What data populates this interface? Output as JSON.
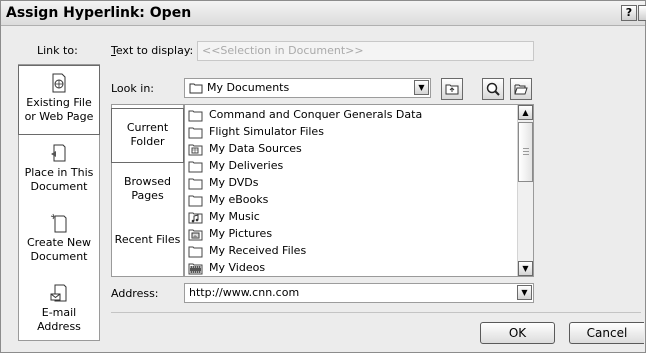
{
  "window": {
    "title": "Assign Hyperlink: Open",
    "help_glyph": "?",
    "close_glyph": "✕"
  },
  "link_to": {
    "label": "Link to:",
    "items": [
      {
        "label": "Existing File or Web Page",
        "icon": "file-web-icon",
        "active": true
      },
      {
        "label": "Place in This Document",
        "icon": "place-in-document-icon"
      },
      {
        "label": "Create New Document",
        "icon": "new-document-icon"
      },
      {
        "label": "E-mail Address",
        "icon": "email-icon"
      }
    ]
  },
  "text_to_display": {
    "label": "Text to display:",
    "value": "<<Selection in Document>>"
  },
  "look_in": {
    "label": "Look in:",
    "value": "My Documents"
  },
  "browse": {
    "items": [
      {
        "label": "Current Folder",
        "active": true
      },
      {
        "label": "Browsed Pages"
      },
      {
        "label": "Recent Files"
      }
    ]
  },
  "files": [
    {
      "name": "Command and Conquer Generals Data",
      "icon": "folder-icon"
    },
    {
      "name": "Flight Simulator Files",
      "icon": "folder-icon"
    },
    {
      "name": "My Data Sources",
      "icon": "data-sources-folder-icon"
    },
    {
      "name": "My Deliveries",
      "icon": "folder-icon"
    },
    {
      "name": "My DVDs",
      "icon": "folder-icon"
    },
    {
      "name": "My eBooks",
      "icon": "folder-icon"
    },
    {
      "name": "My Music",
      "icon": "music-folder-icon"
    },
    {
      "name": "My Pictures",
      "icon": "pictures-folder-icon"
    },
    {
      "name": "My Received Files",
      "icon": "folder-icon"
    },
    {
      "name": "My Videos",
      "icon": "videos-folder-icon"
    }
  ],
  "address": {
    "label": "Address:",
    "value": "http://www.cnn.com"
  },
  "buttons": {
    "ok": "OK",
    "cancel": "Cancel"
  }
}
